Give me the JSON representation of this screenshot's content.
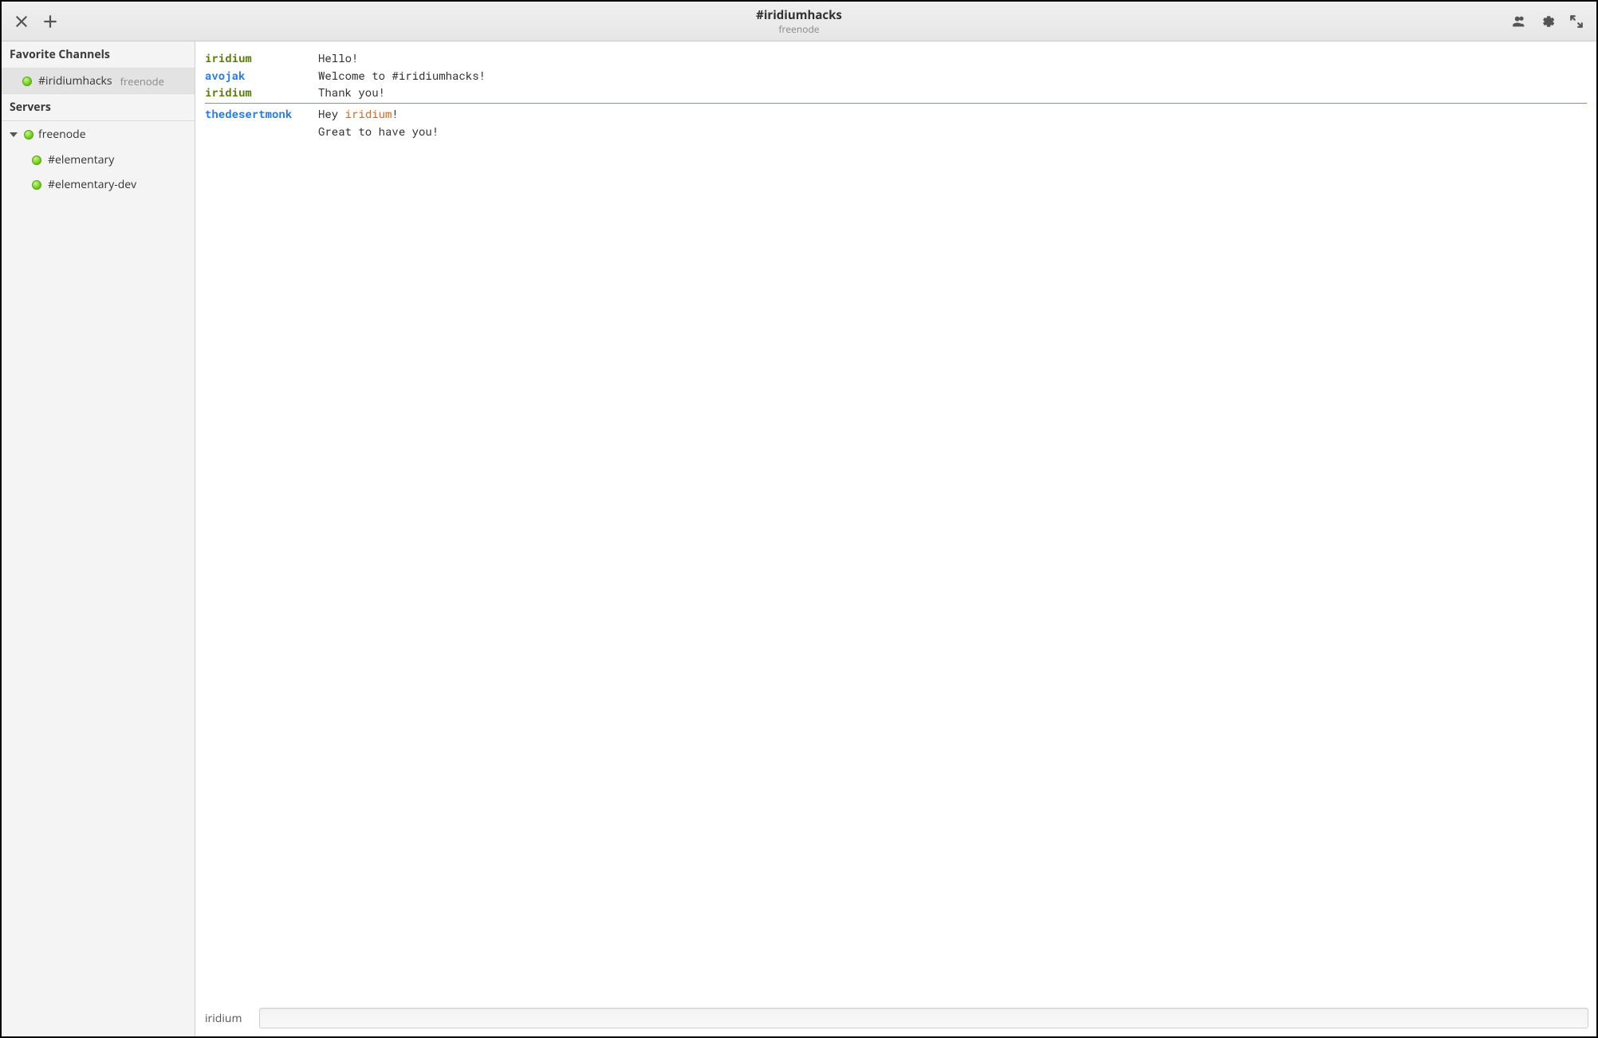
{
  "header": {
    "title": "#iridiumhacks",
    "subtitle": "freenode"
  },
  "sidebar": {
    "favorites_label": "Favorite Channels",
    "favorites": [
      {
        "name": "#iridiumhacks",
        "server": "freenode",
        "selected": true
      }
    ],
    "servers_label": "Servers",
    "servers": [
      {
        "name": "freenode",
        "expanded": true,
        "channels": [
          {
            "name": "#elementary"
          },
          {
            "name": "#elementary-dev"
          }
        ]
      }
    ]
  },
  "chat": {
    "messages": [
      {
        "nick": "iridium",
        "nick_color": "olive",
        "parts": [
          {
            "t": "Hello!"
          }
        ]
      },
      {
        "nick": "avojak",
        "nick_color": "blue",
        "parts": [
          {
            "t": "Welcome to #iridiumhacks!"
          }
        ]
      },
      {
        "nick": "iridium",
        "nick_color": "olive",
        "parts": [
          {
            "t": "Thank you!"
          }
        ],
        "marker_after": true
      },
      {
        "nick": "thedesertmonk",
        "nick_color": "blue",
        "parts": [
          {
            "t": "Hey "
          },
          {
            "t": "iridium",
            "hl": "orange"
          },
          {
            "t": "!"
          }
        ]
      },
      {
        "nick": "",
        "nick_color": "",
        "parts": [
          {
            "t": "Great to have you!"
          }
        ]
      }
    ]
  },
  "input": {
    "nick": "iridium",
    "value": "",
    "placeholder": ""
  }
}
